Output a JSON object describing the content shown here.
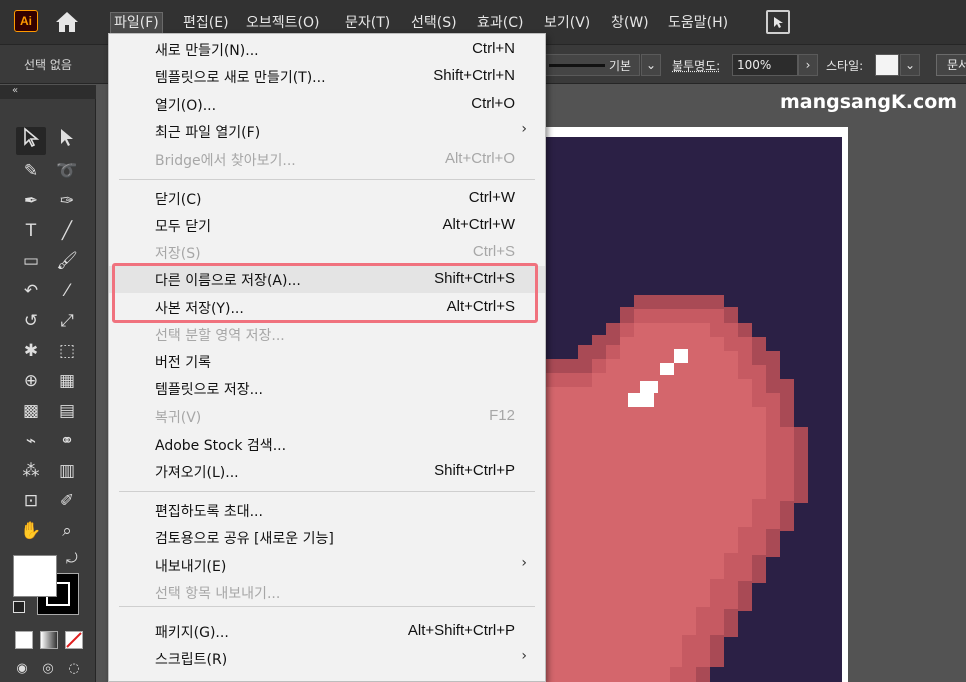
{
  "app": {
    "logo": "Ai",
    "home_icon": "home-icon",
    "workspace_icon": "workspace-switcher-icon"
  },
  "menubar": [
    {
      "label": "파일(F)",
      "active": true
    },
    {
      "label": "편집(E)"
    },
    {
      "label": "오브젝트(O)"
    },
    {
      "label": "문자(T)"
    },
    {
      "label": "선택(S)"
    },
    {
      "label": "효과(C)"
    },
    {
      "label": "보기(V)"
    },
    {
      "label": "창(W)"
    },
    {
      "label": "도움말(H)"
    }
  ],
  "controlbar": {
    "selection_status": "선택 없음",
    "stroke_style": "기본",
    "opacity_label": "불투명도:",
    "opacity_value": "100%",
    "style_label": "스타일:",
    "doc_button": "문서"
  },
  "canvas": {
    "watermark": "mangsangK.com"
  },
  "file_menu": {
    "items": [
      {
        "label": "새로 만들기(N)...",
        "shortcut": "Ctrl+N"
      },
      {
        "label": "템플릿으로 새로 만들기(T)...",
        "shortcut": "Shift+Ctrl+N"
      },
      {
        "label": "열기(O)...",
        "shortcut": "Ctrl+O"
      },
      {
        "label": "최근 파일 열기(F)",
        "shortcut": "",
        "submenu": true
      },
      {
        "label": "Bridge에서 찾아보기...",
        "shortcut": "Alt+Ctrl+O",
        "disabled": true
      },
      {
        "separator": true
      },
      {
        "label": "닫기(C)",
        "shortcut": "Ctrl+W"
      },
      {
        "label": "모두 닫기",
        "shortcut": "Alt+Ctrl+W"
      },
      {
        "label": "저장(S)",
        "shortcut": "Ctrl+S",
        "disabled": true
      },
      {
        "label": "다른 이름으로 저장(A)...",
        "shortcut": "Shift+Ctrl+S",
        "highlighted": true
      },
      {
        "label": "사본 저장(Y)...",
        "shortcut": "Alt+Ctrl+S"
      },
      {
        "label": "선택 분할 영역 저장...",
        "shortcut": "",
        "disabled": true
      },
      {
        "label": "버전 기록",
        "shortcut": ""
      },
      {
        "label": "템플릿으로 저장...",
        "shortcut": ""
      },
      {
        "label": "복귀(V)",
        "shortcut": "F12",
        "disabled": true
      },
      {
        "label": "Adobe Stock 검색...",
        "shortcut": ""
      },
      {
        "label": "가져오기(L)...",
        "shortcut": "Shift+Ctrl+P"
      },
      {
        "separator": true
      },
      {
        "label": "편집하도록 초대...",
        "shortcut": ""
      },
      {
        "label": "검토용으로 공유 [새로운 기능]",
        "shortcut": ""
      },
      {
        "label": "내보내기(E)",
        "shortcut": "",
        "submenu": true
      },
      {
        "label": "선택 항목 내보내기...",
        "shortcut": "",
        "disabled": true
      },
      {
        "separator": true
      },
      {
        "label": "패키지(G)...",
        "shortcut": "Alt+Shift+Ctrl+P"
      },
      {
        "label": "스크립트(R)",
        "shortcut": "",
        "submenu": true
      }
    ]
  },
  "colors": {
    "highlight_border": "#f0727e",
    "artboard_bg": "#2b2045",
    "heart_main": "#d4666c",
    "heart_dark": "#a94a55",
    "heart_mid": "#c65a62"
  }
}
